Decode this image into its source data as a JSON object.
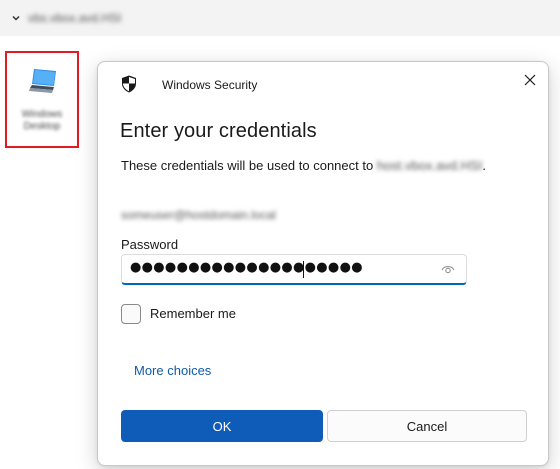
{
  "background": {
    "header_text": "vbs.vbox.avd.HSI"
  },
  "shortcut": {
    "icon": "remote-desktop-icon",
    "label_line1": "Windows",
    "label_line2": "Desktop"
  },
  "dialog": {
    "app_title": "Windows Security",
    "heading": "Enter your credentials",
    "description": "These credentials will be used to connect to ",
    "host_name": "host.vbox.avd.HSI",
    "description_end": ".",
    "username": "someuser@hostdomain.local",
    "password_label": "Password",
    "password_value": "●●●●●●●●●●●●●●●●●●●●",
    "remember_label": "Remember me",
    "remember_checked": false,
    "more_choices_label": "More choices",
    "ok_label": "OK",
    "cancel_label": "Cancel"
  },
  "colors": {
    "accent": "#0f5cb8",
    "link": "#0e5ca8",
    "highlight_border": "#e01b24"
  }
}
